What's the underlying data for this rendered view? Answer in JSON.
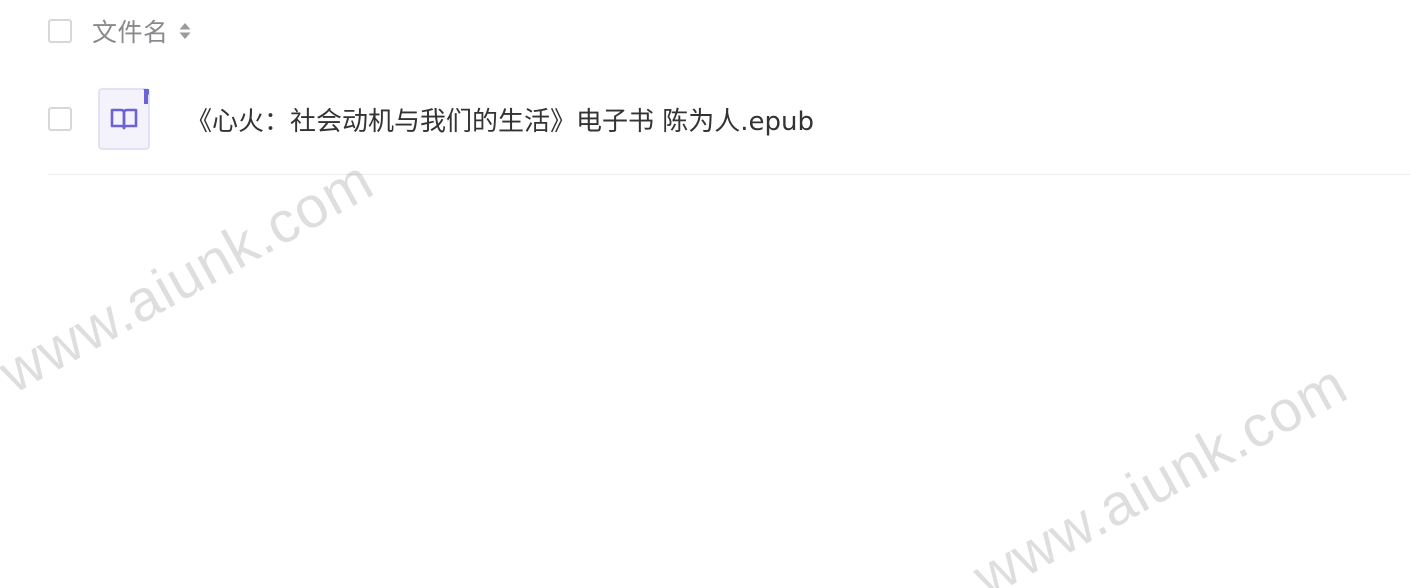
{
  "header": {
    "name_column_label": "文件名",
    "select_all_checked": false
  },
  "files": [
    {
      "name": "《心火：社会动机与我们的生活》电子书 陈为人.epub",
      "type_icon": "book-icon",
      "checked": false
    }
  ],
  "watermark": {
    "text": "www.aiunk.com"
  },
  "colors": {
    "icon_accent": "#6c62d6",
    "icon_background": "#f4f3fc",
    "text_primary": "#333336",
    "text_secondary": "#8a8a8e",
    "border": "#d7d7da"
  }
}
